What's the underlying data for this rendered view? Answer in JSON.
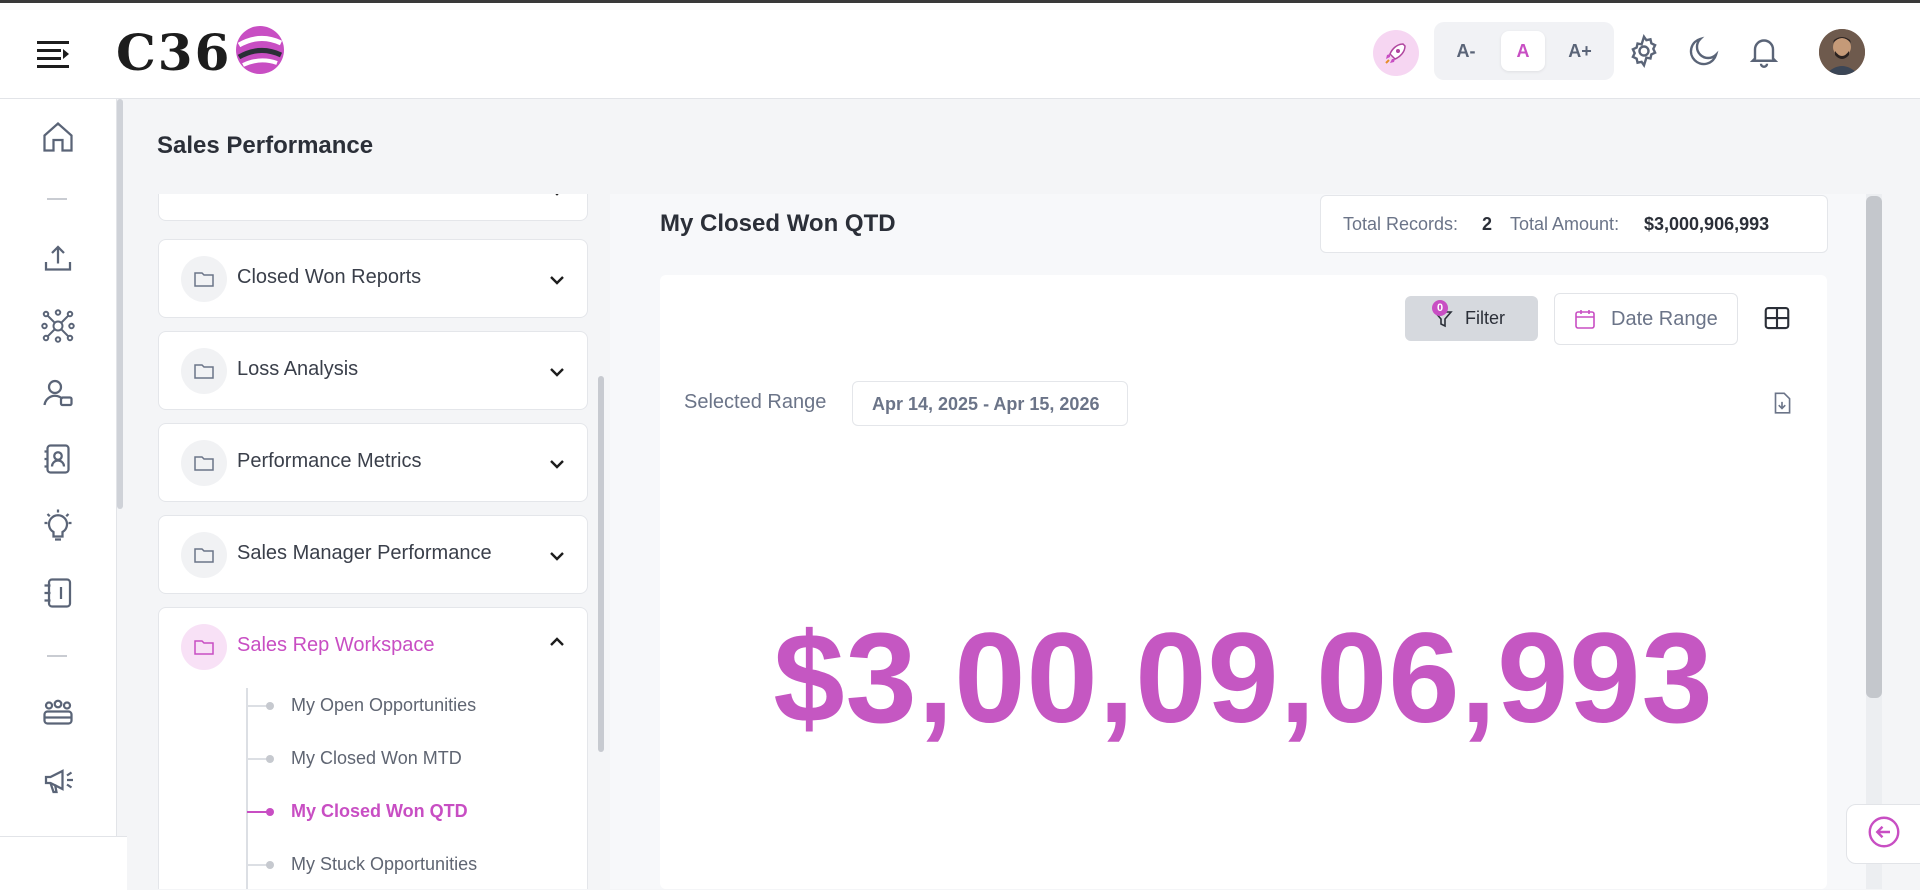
{
  "header": {
    "logo_text": "C36",
    "font_size_buttons": [
      "A-",
      "A",
      "A+"
    ],
    "active_font_size": "A"
  },
  "page": {
    "title": "Sales Performance"
  },
  "folders": {
    "items": [
      {
        "label": "Closed Won Reports",
        "icon": "folder-icon",
        "expanded": false
      },
      {
        "label": "Loss Analysis",
        "icon": "folder-icon",
        "expanded": false
      },
      {
        "label": "Performance Metrics",
        "icon": "folder-icon",
        "expanded": false
      },
      {
        "label": "Sales Manager Performance",
        "icon": "folder-icon",
        "expanded": false
      },
      {
        "label": "Sales Rep Workspace",
        "icon": "folder-icon",
        "expanded": true
      }
    ],
    "sub_items": [
      {
        "label": "My Open Opportunities",
        "active": false
      },
      {
        "label": "My Closed Won MTD",
        "active": false
      },
      {
        "label": "My Closed Won QTD",
        "active": true
      },
      {
        "label": "My Stuck Opportunities",
        "active": false
      }
    ]
  },
  "report": {
    "title": "My Closed Won QTD",
    "total_records_label": "Total Records:",
    "total_records_value": "2",
    "total_amount_label": "Total Amount:",
    "total_amount_value": "$3,000,906,993",
    "filter_label": "Filter",
    "filter_count": "0",
    "date_range_label": "Date Range",
    "selected_range_label": "Selected Range",
    "selected_range_value": "Apr 14, 2025 - Apr 15, 2026",
    "big_value": "$3,00,09,06,993"
  },
  "colors": {
    "accent": "#c84ec3",
    "big_number": "#c557c2",
    "text": "#2b2f38",
    "muted": "#6b7488"
  }
}
